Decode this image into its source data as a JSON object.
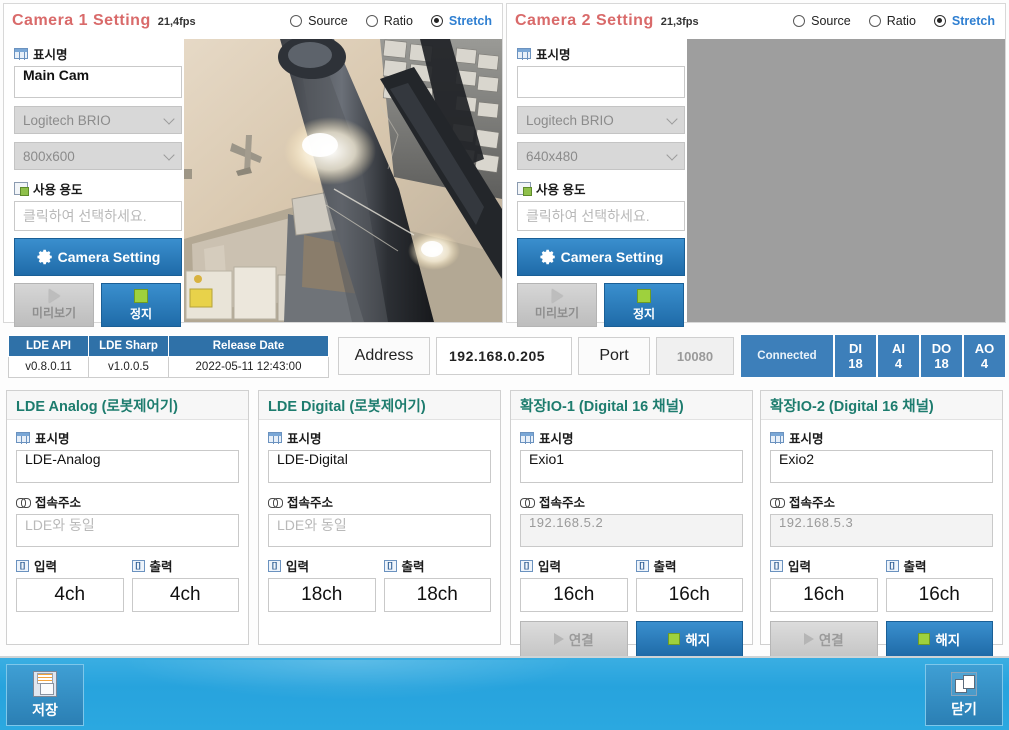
{
  "cameras": [
    {
      "title": "Camera 1 Setting",
      "fps": "21,4fps",
      "view_modes": [
        {
          "label": "Source",
          "selected": false
        },
        {
          "label": "Ratio",
          "selected": false
        },
        {
          "label": "Stretch",
          "selected": true
        }
      ],
      "display_name_label": "표시명",
      "display_name_value": "Main Cam",
      "device": "Logitech BRIO",
      "resolution": "800x600",
      "usage_label": "사용 용도",
      "usage_placeholder": "클릭하여 선택하세요.",
      "setting_button": "Camera Setting",
      "preview_button": "미리보기",
      "stop_button": "정지",
      "video_state": "live"
    },
    {
      "title": "Camera 2 Setting",
      "fps": "21,3fps",
      "view_modes": [
        {
          "label": "Source",
          "selected": false
        },
        {
          "label": "Ratio",
          "selected": false
        },
        {
          "label": "Stretch",
          "selected": true
        }
      ],
      "display_name_label": "표시명",
      "display_name_value": "",
      "device": "Logitech BRIO",
      "resolution": "640x480",
      "usage_label": "사용 용도",
      "usage_placeholder": "클릭하여 선택하세요.",
      "setting_button": "Camera Setting",
      "preview_button": "미리보기",
      "stop_button": "정지",
      "video_state": "blank"
    }
  ],
  "version_table": {
    "headers": [
      "LDE API",
      "LDE Sharp",
      "Release Date"
    ],
    "values": [
      "v0.8.0.11",
      "v1.0.0.5",
      "2022-05-11 12:43:00"
    ]
  },
  "network": {
    "address_label": "Address",
    "address_value": "192.168.0.205",
    "port_label": "Port",
    "port_value": "10080",
    "status": "Connected",
    "counters": [
      {
        "key": "DI",
        "value": "18"
      },
      {
        "key": "AI",
        "value": "4"
      },
      {
        "key": "DO",
        "value": "18"
      },
      {
        "key": "AO",
        "value": "4"
      }
    ]
  },
  "io_panels": [
    {
      "title": "LDE  Analog (로봇제어기)",
      "name_label": "표시명",
      "name_value": "LDE-Analog",
      "addr_label": "접속주소",
      "addr_value": "LDE와 동일",
      "addr_is_placeholder": true,
      "in_label": "입력",
      "in_value": "4ch",
      "out_label": "출력",
      "out_value": "4ch",
      "has_actions": false,
      "connect_button": "",
      "disconnect_button": ""
    },
    {
      "title": "LDE  Digital (로봇제어기)",
      "name_label": "표시명",
      "name_value": "LDE-Digital",
      "addr_label": "접속주소",
      "addr_value": "LDE와 동일",
      "addr_is_placeholder": true,
      "in_label": "입력",
      "in_value": "18ch",
      "out_label": "출력",
      "out_value": "18ch",
      "has_actions": false,
      "connect_button": "",
      "disconnect_button": ""
    },
    {
      "title": "확장IO-1 (Digital 16 채널)",
      "name_label": "표시명",
      "name_value": "Exio1",
      "addr_label": "접속주소",
      "addr_value": "192.168.5.2",
      "addr_is_placeholder": false,
      "in_label": "입력",
      "in_value": "16ch",
      "out_label": "출력",
      "out_value": "16ch",
      "has_actions": true,
      "connect_button": "연결",
      "disconnect_button": "해지"
    },
    {
      "title": "확장IO-2 (Digital 16 채널)",
      "name_label": "표시명",
      "name_value": "Exio2",
      "addr_label": "접속주소",
      "addr_value": "192.168.5.3",
      "addr_is_placeholder": false,
      "in_label": "입력",
      "in_value": "16ch",
      "out_label": "출력",
      "out_value": "16ch",
      "has_actions": true,
      "connect_button": "연결",
      "disconnect_button": "해지"
    }
  ],
  "bottom_bar": {
    "save_label": "저장",
    "close_label": "닫기"
  },
  "colors": {
    "camera_title": "#d96a6a",
    "accent_blue": "#2f7fd1",
    "panel_header_teal": "#1d7c6e",
    "segment_blue": "#3d7fba",
    "bottom_bar": "#2ba8e0"
  }
}
